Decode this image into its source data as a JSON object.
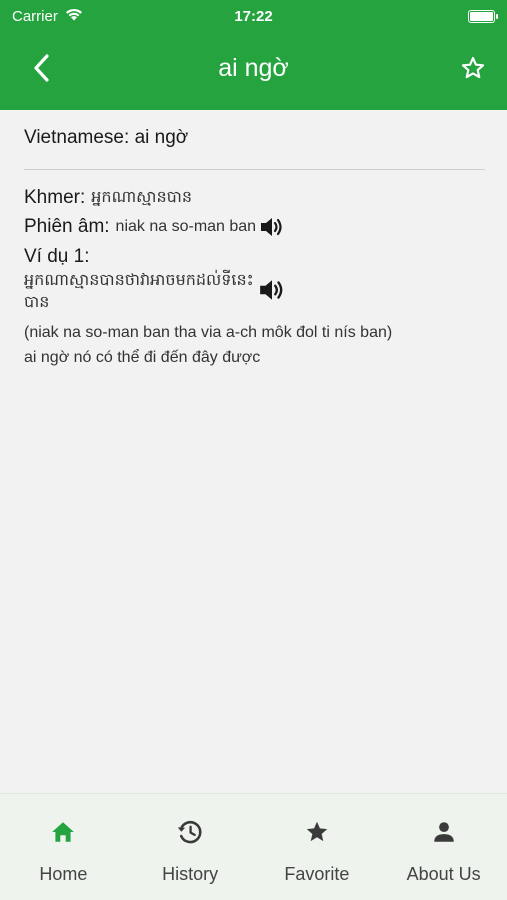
{
  "status_bar": {
    "carrier": "Carrier",
    "time": "17:22"
  },
  "header": {
    "title": "ai ngờ",
    "back_icon": "chevron-left-icon",
    "favorite_icon": "star-outline-icon",
    "color": "#24a33f"
  },
  "entry": {
    "vietnamese_label": "Vietnamese:",
    "vietnamese_value": "ai ngờ",
    "khmer_label": "Khmer:",
    "khmer_value": "អ្នកណាស្មានបាន",
    "phonetic_label": "Phiên âm:",
    "phonetic_value": "niak na so-man ban",
    "example_label": "Ví dụ 1:",
    "example_khmer": "អ្នកណាស្មានបានថាវាអាចមកដល់ទីនេះបាន",
    "example_romanized": "(niak na so-man ban tha via a-ch môk đol ti nís ban)",
    "example_meaning": "ai ngờ nó có thể đi đến đây được",
    "speaker_icon": "speaker-icon"
  },
  "tabs": [
    {
      "label": "Home",
      "icon": "home-icon",
      "active": true
    },
    {
      "label": "History",
      "icon": "history-icon",
      "active": false
    },
    {
      "label": "Favorite",
      "icon": "star-icon",
      "active": false
    },
    {
      "label": "About Us",
      "icon": "person-icon",
      "active": false
    }
  ],
  "colors": {
    "accent": "#24a33f",
    "tab_icon_inactive": "#3a3a3a"
  }
}
